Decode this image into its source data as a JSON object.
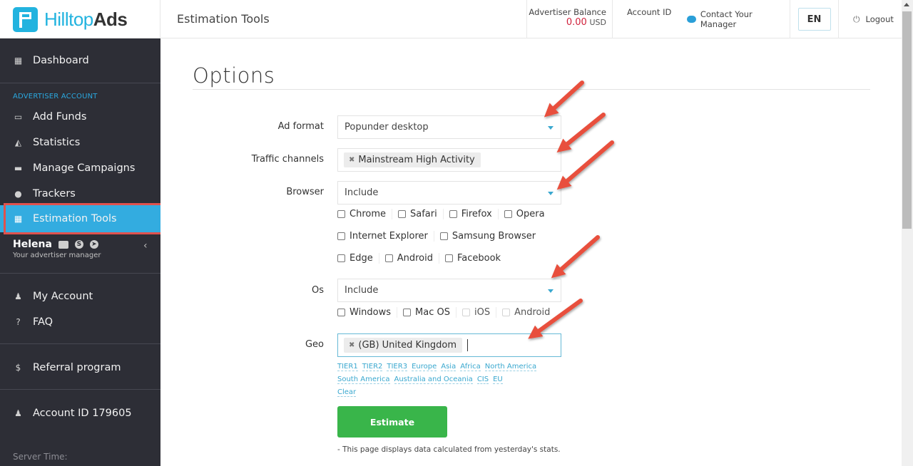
{
  "header": {
    "brand_part1": "Hilltop",
    "brand_part2": "Ads",
    "page_title": "Estimation Tools",
    "balance_label": "Advertiser Balance",
    "balance_amount": "0.00",
    "balance_currency": "USD",
    "account_id_label": "Account ID",
    "contact_label": "Contact Your Manager",
    "language": "EN",
    "logout_label": "Logout"
  },
  "sidebar": {
    "dashboard": "Dashboard",
    "section_label": "ADVERTISER ACCOUNT",
    "items": [
      {
        "label": "Add Funds",
        "icon": "credit-card-icon"
      },
      {
        "label": "Statistics",
        "icon": "area-chart-icon"
      },
      {
        "label": "Manage Campaigns",
        "icon": "briefcase-icon"
      },
      {
        "label": "Trackers",
        "icon": "users-icon"
      },
      {
        "label": "Estimation Tools",
        "icon": "calculator-icon",
        "active": true
      }
    ],
    "manager_name": "Helena",
    "manager_sub": "Your advertiser manager",
    "my_account": "My Account",
    "faq": "FAQ",
    "referral": "Referral program",
    "account_id": "Account ID 179605",
    "server_time": "Server Time:"
  },
  "main": {
    "title": "Options",
    "ad_format": {
      "label": "Ad format",
      "value": "Popunder desktop"
    },
    "traffic_channels": {
      "label": "Traffic channels",
      "tags": [
        "Mainstream High Activity"
      ]
    },
    "browser": {
      "label": "Browser",
      "mode": "Include",
      "rows": [
        [
          "Chrome",
          "Safari",
          "Firefox",
          "Opera"
        ],
        [
          "Internet Explorer",
          "Samsung Browser"
        ],
        [
          "Edge",
          "Android",
          "Facebook"
        ]
      ]
    },
    "os": {
      "label": "Os",
      "mode": "Include",
      "options": [
        {
          "label": "Windows",
          "disabled": false
        },
        {
          "label": "Mac OS",
          "disabled": false
        },
        {
          "label": "iOS",
          "disabled": true
        },
        {
          "label": "Android",
          "disabled": true
        }
      ]
    },
    "geo": {
      "label": "Geo",
      "tags": [
        "(GB) United Kingdom"
      ],
      "quick_links": [
        "TIER1",
        "TIER2",
        "TIER3",
        "Europe",
        "Asia",
        "Africa",
        "North America",
        "South America",
        "Australia and Oceania",
        "CIS",
        "EU"
      ],
      "clear_label": "Clear"
    },
    "estimate_label": "Estimate",
    "note": "- This page displays data calculated from yesterday's stats."
  },
  "colors": {
    "brand": "#22b3df",
    "sidebar_bg": "#2d2e36",
    "active_item": "#33ace0",
    "highlight_outline": "#e0524d",
    "balance_amount": "#d0213b",
    "estimate_button": "#39b54a",
    "annotation_arrow": "#e8503e"
  }
}
